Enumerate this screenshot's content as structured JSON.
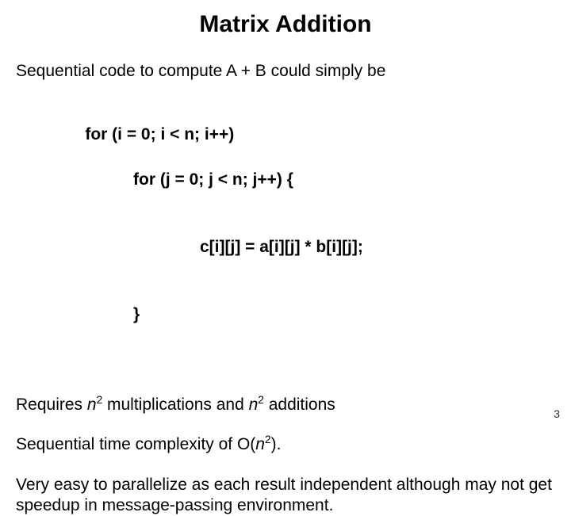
{
  "title": "Matrix Addition",
  "intro": "Sequential code to compute A + B could simply be",
  "code": {
    "l1": "for (i = 0; i < n; i++)",
    "l2": "for (j = 0; j < n; j++) {",
    "l3": "c[i][j] = a[i][j] * b[i][j];",
    "l4": "}"
  },
  "req": {
    "a": "Requires ",
    "n1": "n",
    "e1": "2",
    "b": " multiplications and ",
    "n2": "n",
    "e2": "2",
    "c": " additions"
  },
  "tc": {
    "a": "Sequential time complexity of O(",
    "n": "n",
    "e": "2",
    "b": ")."
  },
  "par": "Very easy to parallelize as each result independent although may not get speedup in message-passing environment.",
  "page": "3"
}
